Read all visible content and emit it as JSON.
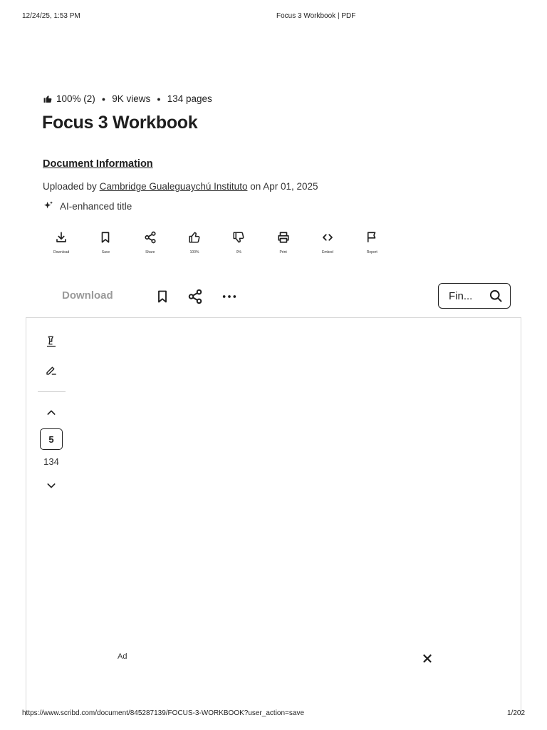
{
  "print_header": {
    "datetime": "12/24/25, 1:53 PM",
    "page_title": "Focus 3 Workbook | PDF"
  },
  "stats": {
    "rating": "100% (2)",
    "views": "9K views",
    "pages": "134 pages"
  },
  "document": {
    "title": "Focus 3 Workbook",
    "info_heading": "Document Information",
    "uploaded_prefix": "Uploaded by",
    "uploader": "Cambridge Gualeguaychú Instituto",
    "date_text": "on Apr 01, 2025",
    "ai_label": "AI-enhanced title"
  },
  "actions": [
    {
      "icon": "download-icon",
      "label": "Download"
    },
    {
      "icon": "bookmark-icon",
      "label": "Save"
    },
    {
      "icon": "share-icon",
      "label": "Share"
    },
    {
      "icon": "thumbs-up-icon",
      "label": "100%"
    },
    {
      "icon": "thumbs-down-icon",
      "label": "0%"
    },
    {
      "icon": "print-icon",
      "label": "Print"
    },
    {
      "icon": "embed-icon",
      "label": "Embed"
    },
    {
      "icon": "flag-icon",
      "label": "Report"
    }
  ],
  "toolbar": {
    "download_label": "Download",
    "find_placeholder": "Fin..."
  },
  "viewer": {
    "current_page": "5",
    "total_pages": "134"
  },
  "ad": {
    "label": "Ad"
  },
  "footer": {
    "url": "https://www.scribd.com/document/845287139/FOCUS-3-WORKBOOK?user_action=save",
    "page_counter": "1/202"
  },
  "colors": {
    "text": "#1e1e1e",
    "muted": "#9a9a9a",
    "border": "#d8d8d8"
  }
}
